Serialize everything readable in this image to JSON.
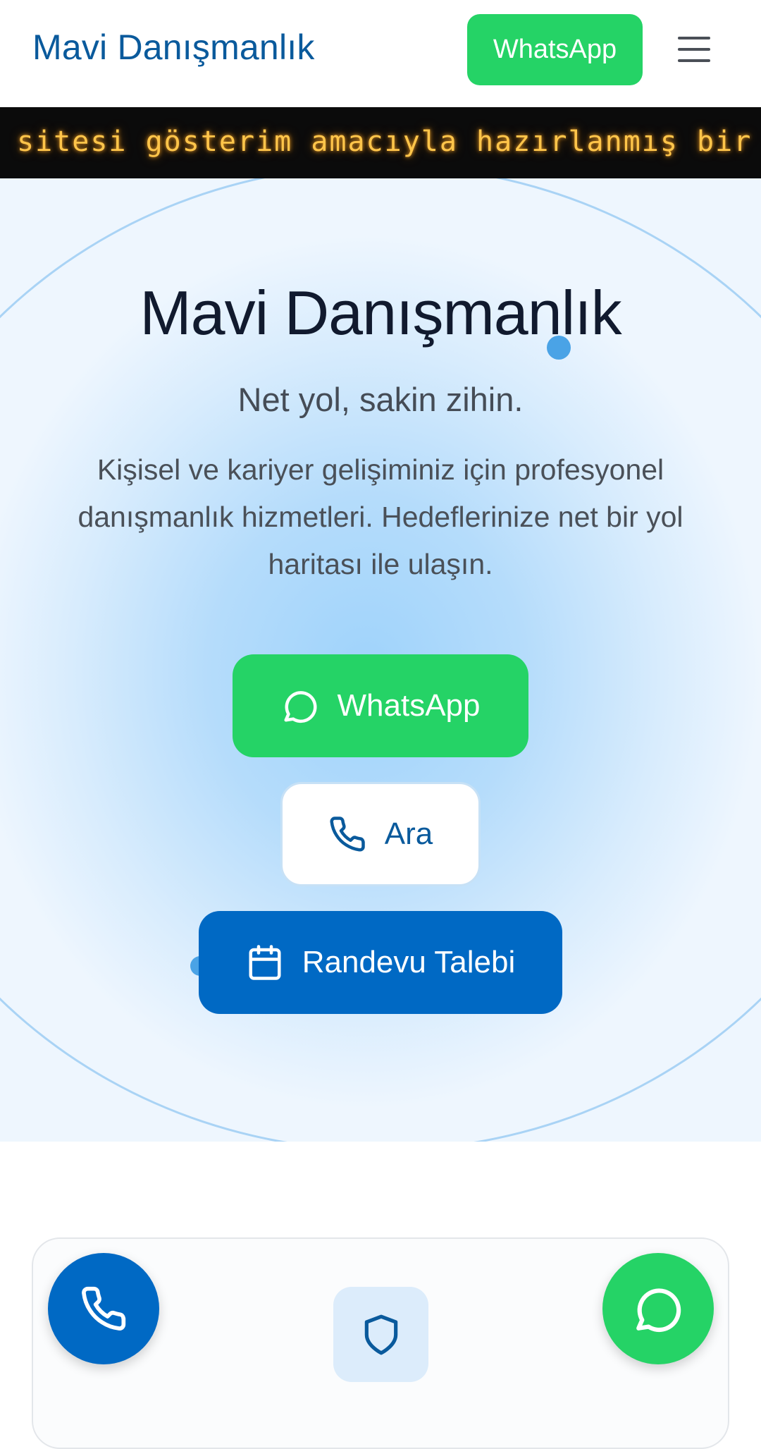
{
  "header": {
    "brand": "Mavi Danışmanlık",
    "whatsapp_label": "WhatsApp",
    "menu_icon": "hamburger-icon"
  },
  "ticker": {
    "text": "sitesi gösterim amacıyla hazırlanmış bir d"
  },
  "hero": {
    "title": "Mavi Danışmanlık",
    "subtitle": "Net yol, sakin zihin.",
    "description": "Kişisel ve kariyer gelişiminiz için profesyonel danışmanlık hizmetleri. Hedeflerinize net bir yol haritası ile ulaşın.",
    "buttons": {
      "whatsapp": "WhatsApp",
      "call": "Ara",
      "appointment": "Randevu Talebi"
    }
  },
  "icons": {
    "whatsapp": "chat-bubble-icon",
    "call": "phone-icon",
    "appointment": "calendar-icon",
    "card": "shield-icon"
  },
  "colors": {
    "brand": "#0a5a9c",
    "whatsapp": "#25d366",
    "primary": "#0069c4",
    "ticker_text": "#ffc54a"
  }
}
